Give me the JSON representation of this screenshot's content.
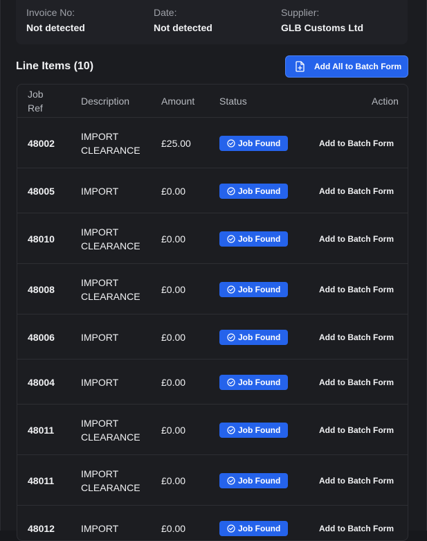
{
  "invoice": {
    "invoice_no_label": "Invoice No:",
    "invoice_no_value": "Not detected",
    "date_label": "Date:",
    "date_value": "Not detected",
    "supplier_label": "Supplier:",
    "supplier_value": "GLB Customs Ltd"
  },
  "line_items": {
    "title": "Line Items (10)",
    "add_all_label": "Add All to Batch Form",
    "columns": {
      "job_ref": "Job Ref",
      "description": "Description",
      "amount": "Amount",
      "status": "Status",
      "action": "Action"
    },
    "rows": [
      {
        "job_ref": "48002",
        "description": "IMPORT CLEARANCE",
        "amount": "£25.00",
        "status": "Job Found",
        "action": "Add to Batch Form"
      },
      {
        "job_ref": "48005",
        "description": "IMPORT",
        "amount": "£0.00",
        "status": "Job Found",
        "action": "Add to Batch Form"
      },
      {
        "job_ref": "48010",
        "description": "IMPORT CLEARANCE",
        "amount": "£0.00",
        "status": "Job Found",
        "action": "Add to Batch Form"
      },
      {
        "job_ref": "48008",
        "description": "IMPORT CLEARANCE",
        "amount": "£0.00",
        "status": "Job Found",
        "action": "Add to Batch Form"
      },
      {
        "job_ref": "48006",
        "description": "IMPORT",
        "amount": "£0.00",
        "status": "Job Found",
        "action": "Add to Batch Form"
      },
      {
        "job_ref": "48004",
        "description": "IMPORT",
        "amount": "£0.00",
        "status": "Job Found",
        "action": "Add to Batch Form"
      },
      {
        "job_ref": "48011",
        "description": "IMPORT CLEARANCE",
        "amount": "£0.00",
        "status": "Job Found",
        "action": "Add to Batch Form"
      },
      {
        "job_ref": "48011",
        "description": "IMPORT CLEARANCE",
        "amount": "£0.00",
        "status": "Job Found",
        "action": "Add to Batch Form"
      },
      {
        "job_ref": "48012",
        "description": "IMPORT",
        "amount": "£0.00",
        "status": "Job Found",
        "action": "Add to Batch Form"
      }
    ]
  },
  "colors": {
    "accent": "#2563eb",
    "background": "#1b1c20",
    "border": "#2d2e33"
  },
  "icons": {
    "add_all": "file-plus-icon",
    "status": "check-circle-icon"
  }
}
